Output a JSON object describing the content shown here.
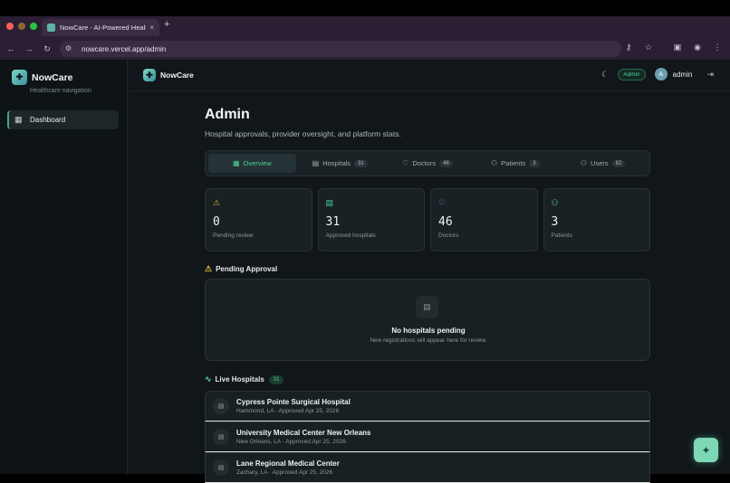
{
  "browser": {
    "tab_title": "NowCare - AI-Powered Healt",
    "tab_close": "×",
    "new_tab": "+",
    "url": "nowcare.vercel.app/admin",
    "colors": {
      "traffic_red": "#ff5f57",
      "traffic_yellow": "#febc2e",
      "traffic_green": "#28c840"
    }
  },
  "sidebar": {
    "brand": "NowCare",
    "subtitle": "Healthcare navigation",
    "items": [
      {
        "label": "Dashboard",
        "icon": "dashboard-grid-icon",
        "active": true
      }
    ]
  },
  "header": {
    "brand": "NowCare",
    "role_badge": "Admin",
    "avatar_initial": "A",
    "username": "admin"
  },
  "page": {
    "title": "Admin",
    "subtitle": "Hospital approvals, provider oversight, and platform stats."
  },
  "tabs": [
    {
      "label": "Overview",
      "count": "",
      "icon": "grid-icon",
      "active": true
    },
    {
      "label": "Hospitals",
      "count": "31",
      "icon": "building-icon"
    },
    {
      "label": "Doctors",
      "count": "46",
      "icon": "stethoscope-icon"
    },
    {
      "label": "Patients",
      "count": "3",
      "icon": "users-icon"
    },
    {
      "label": "Users",
      "count": "82",
      "icon": "users-icon"
    }
  ],
  "stats": [
    {
      "value": "0",
      "label": "Pending review",
      "icon": "warning-icon",
      "color": "#e0b13a"
    },
    {
      "value": "31",
      "label": "Approved hospitals",
      "icon": "building-icon",
      "color": "#4fd39b"
    },
    {
      "value": "46",
      "label": "Doctors",
      "icon": "stethoscope-icon",
      "color": "#b08cf0"
    },
    {
      "value": "3",
      "label": "Patients",
      "icon": "users-icon",
      "color": "#4fd39b"
    }
  ],
  "pending": {
    "title": "Pending Approval",
    "empty_title": "No hospitals pending",
    "empty_sub": "New registrations will appear here for review."
  },
  "live": {
    "title": "Live Hospitals",
    "count": "31",
    "hospitals": [
      {
        "name": "Cypress Pointe Surgical Hospital",
        "meta": "Hammond, LA · Approved Apr 25, 2026"
      },
      {
        "name": "University Medical Center New Orleans",
        "meta": "New Orleans, LA · Approved Apr 25, 2026"
      },
      {
        "name": "Lane Regional Medical Center",
        "meta": "Zachary, LA · Approved Apr 25, 2026"
      }
    ]
  }
}
